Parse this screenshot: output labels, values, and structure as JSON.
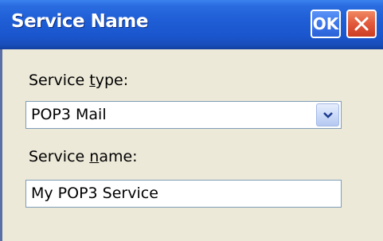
{
  "window": {
    "title": "Service Name",
    "ok_label": "OK"
  },
  "service_type": {
    "label_pre": "Service ",
    "label_accel": "t",
    "label_post": "ype:",
    "value": "POP3 Mail"
  },
  "service_name": {
    "label_pre": "Service ",
    "label_accel": "n",
    "label_post": "ame:",
    "value": "My POP3 Service"
  },
  "icons": {
    "close": "close-icon",
    "dropdown": "chevron-down-icon"
  },
  "colors": {
    "titlebar": "#1f5ed6",
    "dialog_background": "#ece9d8",
    "close_button": "#e2583a",
    "field_border": "#7f9db9"
  }
}
